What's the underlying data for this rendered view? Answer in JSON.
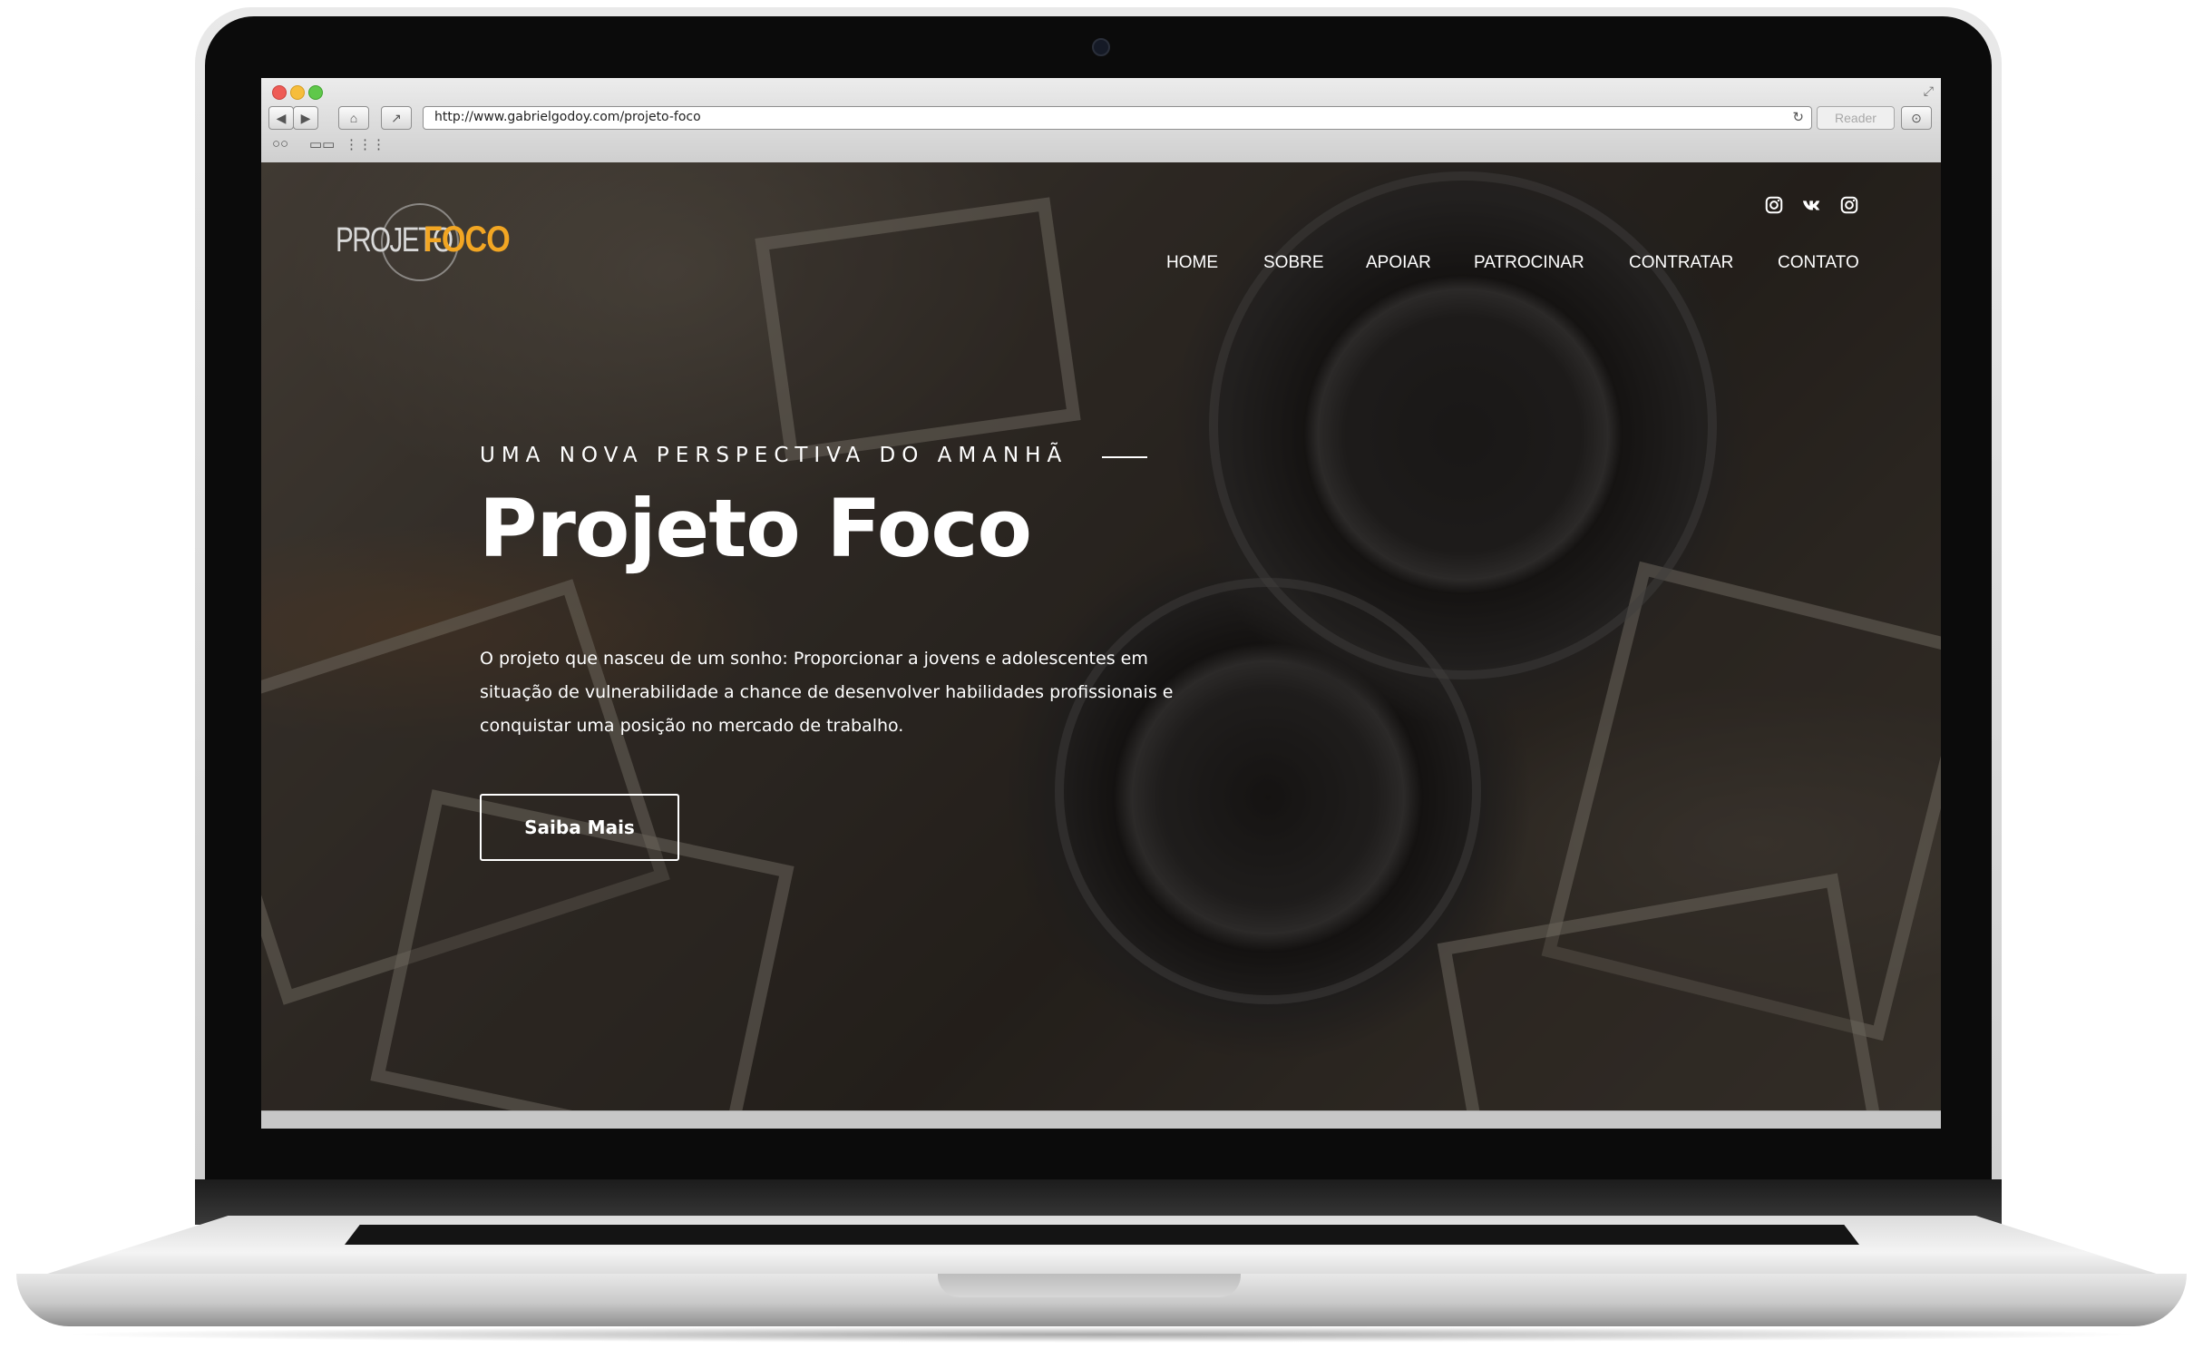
{
  "browser": {
    "url": "http://www.gabrielgodoy.com/projeto-foco",
    "reader_label": "Reader"
  },
  "site": {
    "logo": {
      "part1": "PROJETO",
      "part2": "FOCO"
    },
    "nav": [
      "HOME",
      "SOBRE",
      "APOIAR",
      "PATROCINAR",
      "CONTRATAR",
      "CONTATO"
    ],
    "social_icons": [
      "instagram-icon",
      "vk-icon",
      "instagram-icon"
    ]
  },
  "hero": {
    "eyebrow": "UMA NOVA PERSPECTIVA DO AMANHÃ",
    "title": "Projeto Foco",
    "description": "O projeto que nasceu de um sonho: Proporcionar a jovens e adolescentes em situação de vulnerabilidade a chance de desenvolver habilidades profissionais e conquistar uma posição no mercado de trabalho.",
    "cta": "Saiba Mais"
  },
  "colors": {
    "accent": "#f2a623",
    "text": "#ffffff"
  }
}
